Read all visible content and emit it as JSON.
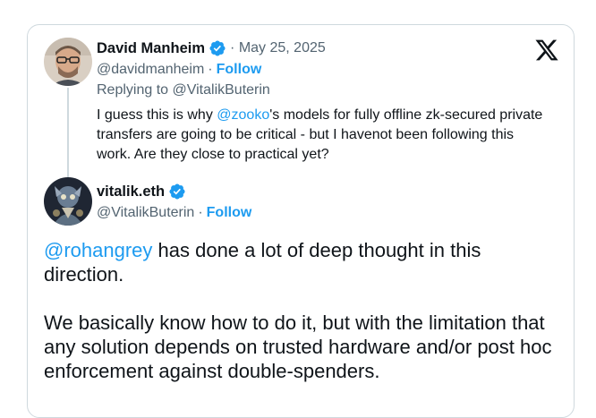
{
  "parent_tweet": {
    "author_name": "David Manheim",
    "date_prefix": "· ",
    "date": "May 25, 2025",
    "handle": "@davidmanheim",
    "separator": "·",
    "follow_label": "Follow",
    "replying_to": "Replying to @VitalikButerin",
    "text_before_mention": "I guess this is why ",
    "mention": "@zooko",
    "text_after_mention": "'s models for fully offline zk-secured private transfers are going to be critical - but I havenot been following this work. Are they close to practical yet?"
  },
  "reply_tweet": {
    "author_name": "vitalik.eth",
    "handle": "@VitalikButerin",
    "separator": "·",
    "follow_label": "Follow",
    "mention": "@rohangrey",
    "paragraph1_after_mention": " has done a lot of deep thought in this direction.",
    "paragraph2": "We basically know how to do it, but with the limitation that any solution depends on trusted hardware and/or post hoc enforcement against double-spenders."
  },
  "colors": {
    "link": "#1d9bf0",
    "muted": "#536471",
    "text": "#0f1419",
    "border": "#cfd9de"
  },
  "icons": {
    "brand": "x-logo-icon",
    "verified": "verified-badge-icon"
  }
}
